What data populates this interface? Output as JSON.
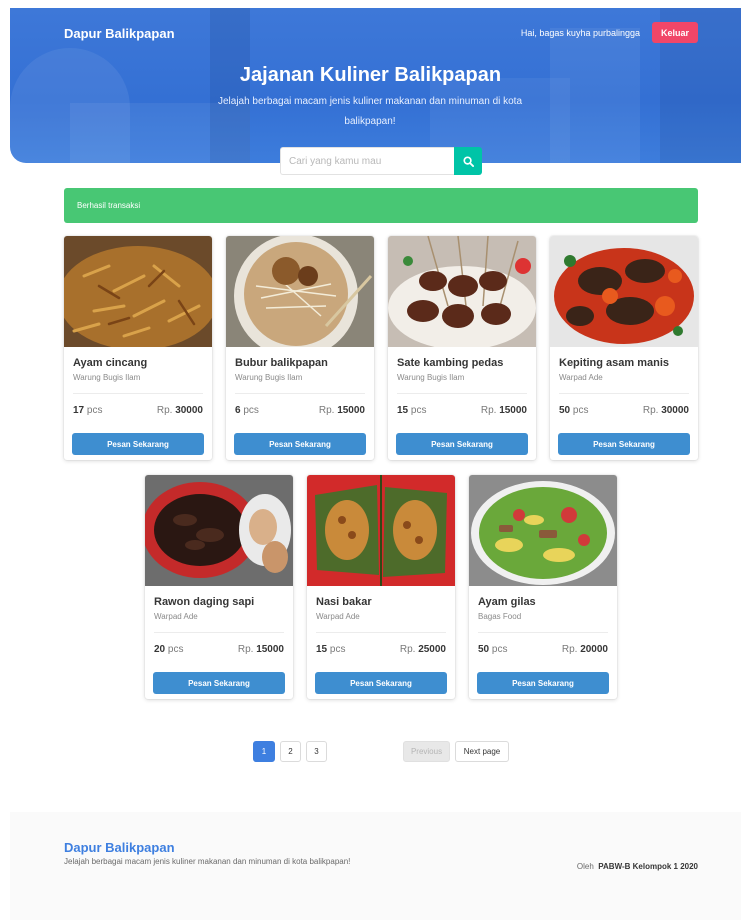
{
  "header": {
    "brand": "Dapur Balikpapan",
    "greeting": "Hai, bagas kuyha purbalingga",
    "logout_label": "Keluar",
    "title": "Jajanan Kuliner Balikpapan",
    "subtitle": "Jelajah berbagai macam jenis kuliner makanan dan minuman di kota balikpapan!"
  },
  "search": {
    "placeholder": "Cari yang kamu mau",
    "value": ""
  },
  "notification": "Berhasil transaksi",
  "colors": {
    "primary": "#3e7fe0",
    "button": "#3e8ed0",
    "success": "#48c774",
    "danger": "#f14668",
    "search": "#00c4a7"
  },
  "products": [
    {
      "name": "Ayam cincang",
      "vendor": "Warung Bugis Ilam",
      "stock": "17",
      "unit": "pcs",
      "currency": "Rp.",
      "price": "30000",
      "cta": "Pesan Sekarang",
      "image": "minced-chicken-image"
    },
    {
      "name": "Bubur balikpapan",
      "vendor": "Warung Bugis Ilam",
      "stock": "6",
      "unit": "pcs",
      "currency": "Rp.",
      "price": "15000",
      "cta": "Pesan Sekarang",
      "image": "porridge-image"
    },
    {
      "name": "Sate kambing pedas",
      "vendor": "Warung Bugis Ilam",
      "stock": "15",
      "unit": "pcs",
      "currency": "Rp.",
      "price": "15000",
      "cta": "Pesan Sekarang",
      "image": "satay-image"
    },
    {
      "name": "Kepiting asam manis",
      "vendor": "Warpad Ade",
      "stock": "50",
      "unit": "pcs",
      "currency": "Rp.",
      "price": "30000",
      "cta": "Pesan Sekarang",
      "image": "crab-image"
    },
    {
      "name": "Rawon daging sapi",
      "vendor": "Warpad Ade",
      "stock": "20",
      "unit": "pcs",
      "currency": "Rp.",
      "price": "15000",
      "cta": "Pesan Sekarang",
      "image": "rawon-image"
    },
    {
      "name": "Nasi bakar",
      "vendor": "Warpad Ade",
      "stock": "15",
      "unit": "pcs",
      "currency": "Rp.",
      "price": "25000",
      "cta": "Pesan Sekarang",
      "image": "grilled-rice-image"
    },
    {
      "name": "Ayam gilas",
      "vendor": "Bagas Food",
      "stock": "50",
      "unit": "pcs",
      "currency": "Rp.",
      "price": "20000",
      "cta": "Pesan Sekarang",
      "image": "salad-image"
    }
  ],
  "pagination": {
    "pages": [
      "1",
      "2",
      "3"
    ],
    "current": "1",
    "previous_label": "Previous",
    "next_label": "Next page"
  },
  "footer": {
    "brand": "Dapur Balikpapan",
    "tagline": "Jelajah berbagai macam jenis kuliner makanan dan minuman di kota balikpapan!",
    "credit_prefix": "Oleh",
    "credit_name": "PABW-B Kelompok 1 2020"
  }
}
